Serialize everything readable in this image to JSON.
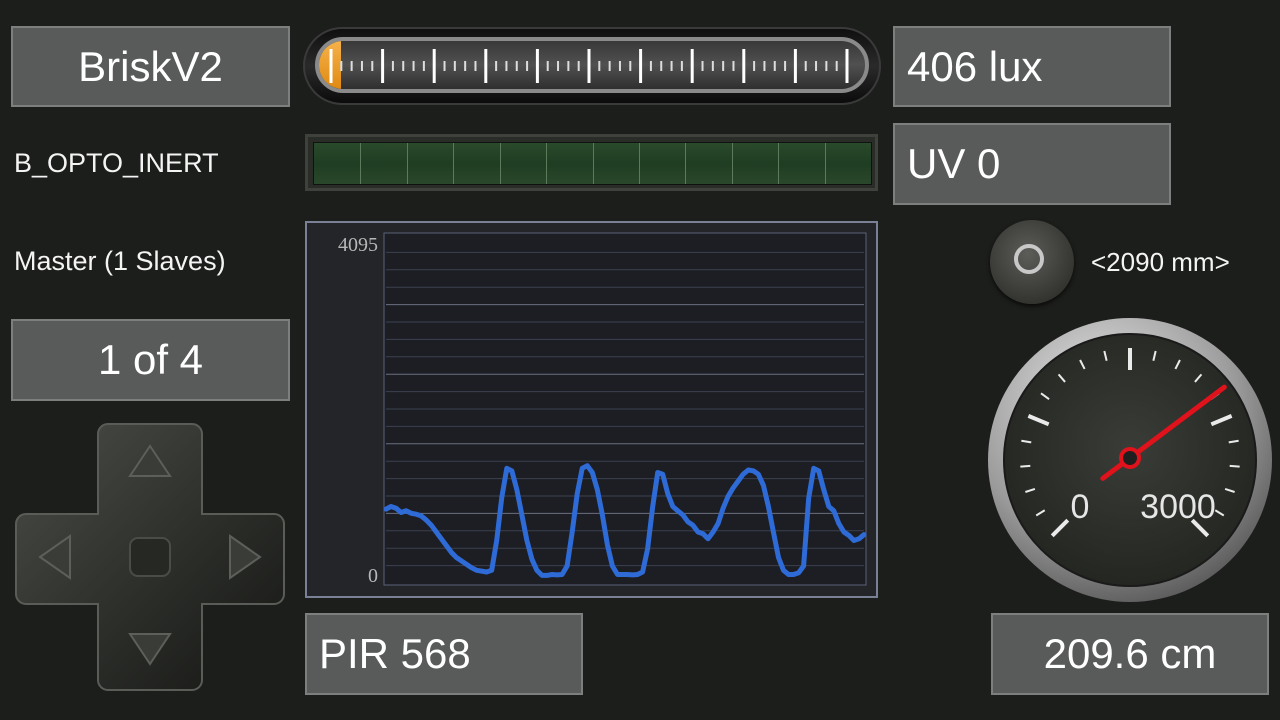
{
  "device": {
    "name": "BriskV2",
    "program": "B_OPTO_INERT",
    "role": "Master (1 Slaves)",
    "page": "1 of 4"
  },
  "slider": {
    "level": 0.03
  },
  "readouts": {
    "lux": "406 lux",
    "uv": "UV 0",
    "distance_mm": "<2090 mm>",
    "pir": "PIR 568",
    "distance_cm": "209.6 cm"
  },
  "bargraph": {
    "level": 0,
    "segments": 12
  },
  "chart_data": {
    "type": "line",
    "ytick_labels": [
      "4095",
      "0"
    ],
    "ylim": [
      0,
      4095
    ],
    "grid": true,
    "line_color": "#2e6bd6",
    "series": [
      {
        "values": [
          870,
          900,
          880,
          830,
          850,
          820,
          810,
          790,
          740,
          680,
          600,
          520,
          440,
          360,
          300,
          260,
          220,
          180,
          150,
          140,
          130,
          150,
          500,
          1000,
          1350,
          1320,
          1100,
          800,
          500,
          280,
          150,
          90,
          90,
          100,
          95,
          100,
          200,
          600,
          1050,
          1350,
          1380,
          1300,
          1100,
          800,
          450,
          200,
          100,
          100,
          100,
          95,
          100,
          130,
          400,
          900,
          1300,
          1280,
          1050,
          900,
          850,
          800,
          720,
          680,
          600,
          580,
          520,
          600,
          700,
          880,
          1020,
          1120,
          1200,
          1280,
          1330,
          1320,
          1280,
          1150,
          900,
          600,
          300,
          150,
          100,
          100,
          120,
          200,
          1000,
          1350,
          1320,
          1100,
          900,
          850,
          700,
          600,
          560,
          500,
          520,
          570
        ]
      }
    ]
  },
  "gauge": {
    "value": 2090,
    "min": 0,
    "max": 3000,
    "min_label": "0",
    "max_label": "3000",
    "needle_color": "#e0121b"
  },
  "dpad": {
    "up": "arrow-up",
    "down": "arrow-down",
    "left": "arrow-left",
    "right": "arrow-right"
  }
}
